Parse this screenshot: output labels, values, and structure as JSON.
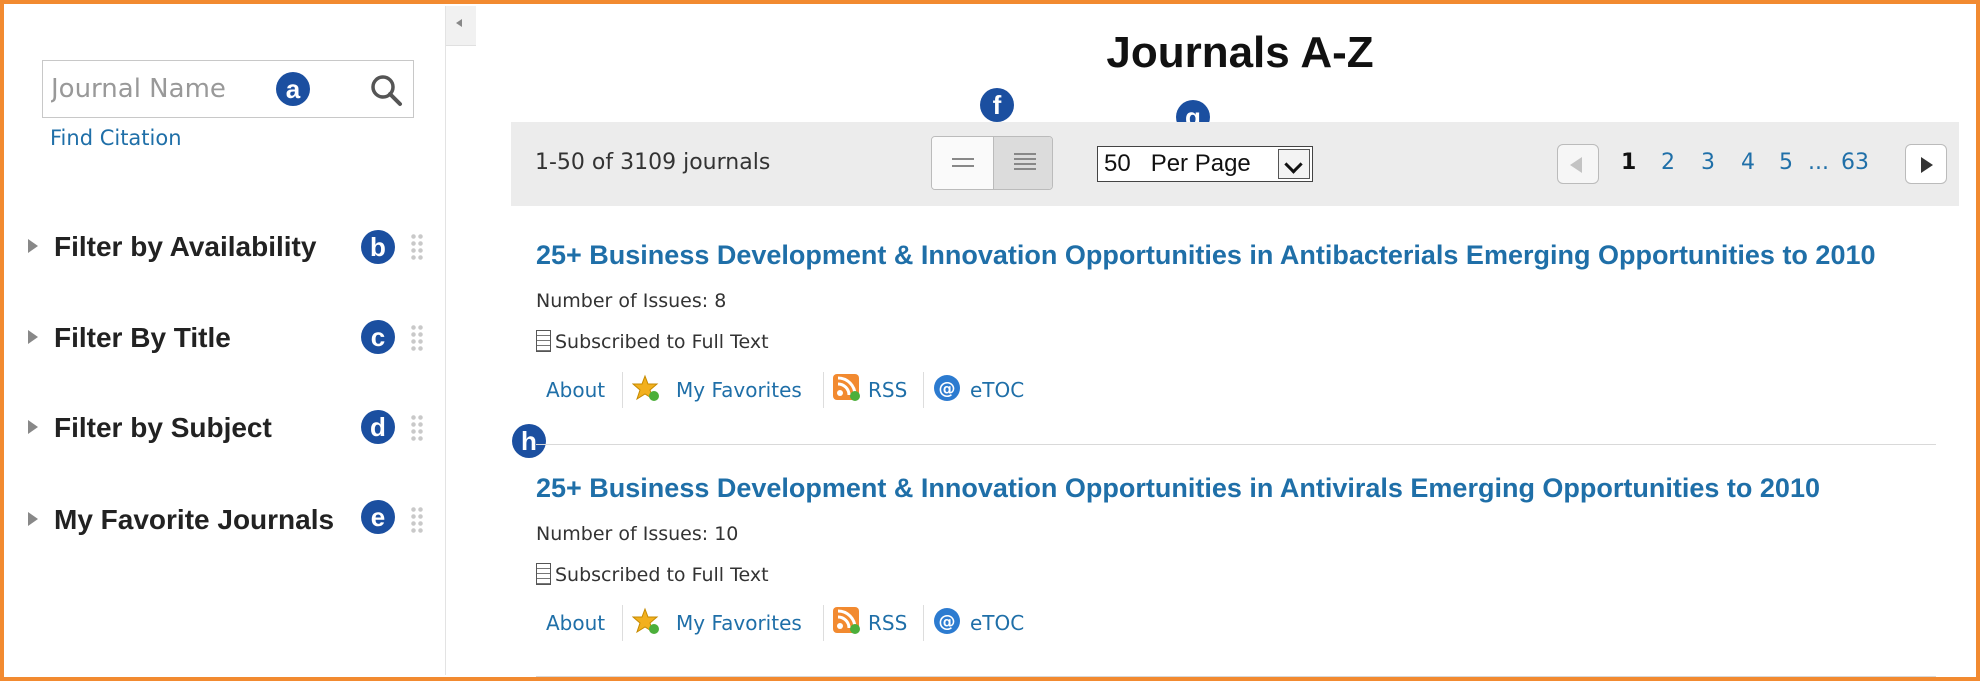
{
  "page": {
    "title": "Journals A-Z"
  },
  "sidebar": {
    "search": {
      "placeholder": "Journal Name"
    },
    "find_citation": "Find Citation",
    "filters": [
      {
        "label": "Filter by Availability",
        "marker": "b"
      },
      {
        "label": "Filter By Title",
        "marker": "c"
      },
      {
        "label": "Filter by Subject",
        "marker": "d"
      },
      {
        "label": "My Favorite Journals",
        "marker": "e"
      }
    ]
  },
  "markers": {
    "a": "a",
    "f": "f",
    "g": "g",
    "h": "h"
  },
  "toolbar": {
    "result_count": "1-50 of 3109 journals",
    "per_page": "50   Per Page",
    "pages": [
      "1",
      "2",
      "3",
      "4",
      "5",
      "...",
      "63"
    ],
    "current_page": "1"
  },
  "journals": [
    {
      "title": "25+ Business Development & Innovation Opportunities in Antibacterials Emerging Opportunities to 2010",
      "issues": "Number of Issues: 8",
      "subscription": "Subscribed to Full Text",
      "links": {
        "about": "About",
        "favorites": "My Favorites",
        "rss": "RSS",
        "etoc": "eTOC"
      }
    },
    {
      "title": "25+ Business Development & Innovation Opportunities in Antivirals Emerging Opportunities to 2010",
      "issues": "Number of Issues: 10",
      "subscription": "Subscribed to Full Text",
      "links": {
        "about": "About",
        "favorites": "My Favorites",
        "rss": "RSS",
        "etoc": "eTOC"
      }
    }
  ],
  "colors": {
    "frame": "#f28a30",
    "marker": "#1b4fa0",
    "link": "#1f6fa8",
    "toolbar_bg": "#ececec"
  }
}
